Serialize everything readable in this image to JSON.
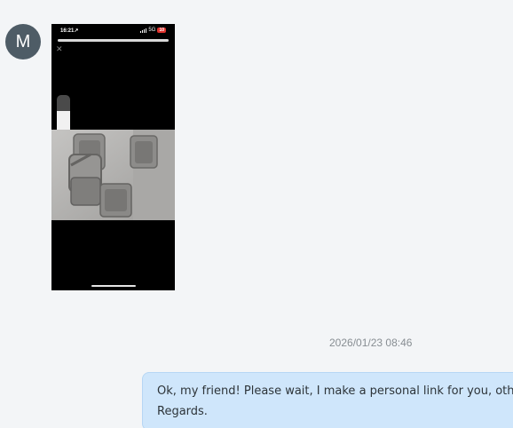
{
  "sender": {
    "avatar_initial": "M",
    "avatar_color": "#4e5c66"
  },
  "attachment": {
    "status_time": "16:21",
    "status_network": "5G",
    "status_battery": "10",
    "status_battery_color": "#e0322d",
    "close_icon": "close-icon",
    "volume_level_fraction": 0.65
  },
  "message": {
    "timestamp": "2026/01/23 08:46",
    "lines": [
      "Ok, my friend! Please wait, I make a personal link for you, otherwi",
      "Regards."
    ],
    "bubble_color": "#cfe6fb"
  }
}
